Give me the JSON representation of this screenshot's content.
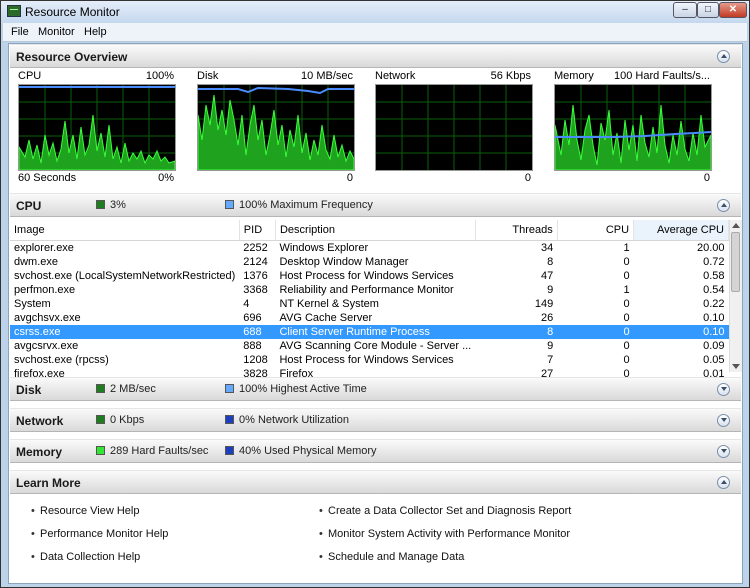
{
  "window": {
    "title": "Resource Monitor",
    "controls": {
      "minimize": "–",
      "maximize": "□",
      "close": "✕"
    }
  },
  "menu": [
    "File",
    "Monitor",
    "Help"
  ],
  "overview": {
    "title": "Resource Overview",
    "graphs": [
      {
        "label": "CPU",
        "value": "100%",
        "foot_left": "60 Seconds",
        "foot_right": "0%"
      },
      {
        "label": "Disk",
        "value": "10 MB/sec",
        "foot_left": "",
        "foot_right": "0"
      },
      {
        "label": "Network",
        "value": "56 Kbps",
        "foot_left": "",
        "foot_right": "0"
      },
      {
        "label": "Memory",
        "value": "100 Hard Faults/s...",
        "foot_left": "",
        "foot_right": "0"
      }
    ]
  },
  "cpu": {
    "title": "CPU",
    "stat1": "3%",
    "stat2": "100% Maximum Frequency",
    "columns": [
      "Image",
      "PID",
      "Description",
      "Threads",
      "CPU",
      "Average CPU"
    ],
    "rows": [
      [
        "explorer.exe",
        "2252",
        "Windows Explorer",
        "34",
        "1",
        "20.00"
      ],
      [
        "dwm.exe",
        "2124",
        "Desktop Window Manager",
        "8",
        "0",
        "0.72"
      ],
      [
        "svchost.exe (LocalSystemNetworkRestricted)",
        "1376",
        "Host Process for Windows Services",
        "47",
        "0",
        "0.58"
      ],
      [
        "perfmon.exe",
        "3368",
        "Reliability and Performance Monitor",
        "9",
        "1",
        "0.54"
      ],
      [
        "System",
        "4",
        "NT Kernel & System",
        "149",
        "0",
        "0.22"
      ],
      [
        "avgchsvx.exe",
        "696",
        "AVG Cache Server",
        "26",
        "0",
        "0.10"
      ],
      [
        "csrss.exe",
        "688",
        "Client Server Runtime Process",
        "8",
        "0",
        "0.10"
      ],
      [
        "avgcsrvx.exe",
        "888",
        "AVG Scanning Core Module - Server ...",
        "9",
        "0",
        "0.09"
      ],
      [
        "svchost.exe (rpcss)",
        "1208",
        "Host Process for Windows Services",
        "7",
        "0",
        "0.05"
      ],
      [
        "firefox.exe",
        "3828",
        "Firefox",
        "27",
        "0",
        "0.01"
      ]
    ],
    "selected_row": 6
  },
  "disk": {
    "title": "Disk",
    "stat1": "2 MB/sec",
    "stat2": "100% Highest Active Time"
  },
  "network": {
    "title": "Network",
    "stat1": "0 Kbps",
    "stat2": "0% Network Utilization"
  },
  "memory": {
    "title": "Memory",
    "stat1": "289 Hard Faults/sec",
    "stat2": "40% Used Physical Memory"
  },
  "learn_more": {
    "title": "Learn More",
    "links": [
      "Resource View Help",
      "Performance Monitor Help",
      "Data Collection Help",
      "Create a Data Collector Set and Diagnosis Report",
      "Monitor System Activity with Performance Monitor",
      "Schedule and Manage Data"
    ]
  },
  "colors": {
    "graph_bg": "#000000",
    "graph_grid": "#0a5e0a",
    "graph_fill": "#1fa31f",
    "graph_line": "#39ff39",
    "frequency_line": "#4a8cff",
    "legend_green": "#1e7d1e",
    "legend_lightblue": "#66aaff",
    "legend_darkblue": "#1b3fbf",
    "legend_lime": "#33e633",
    "selection": "#3399ff"
  },
  "icons": {
    "app": "resource-monitor-icon",
    "expand": "chevron-down-icon",
    "collapse": "chevron-up-icon"
  }
}
